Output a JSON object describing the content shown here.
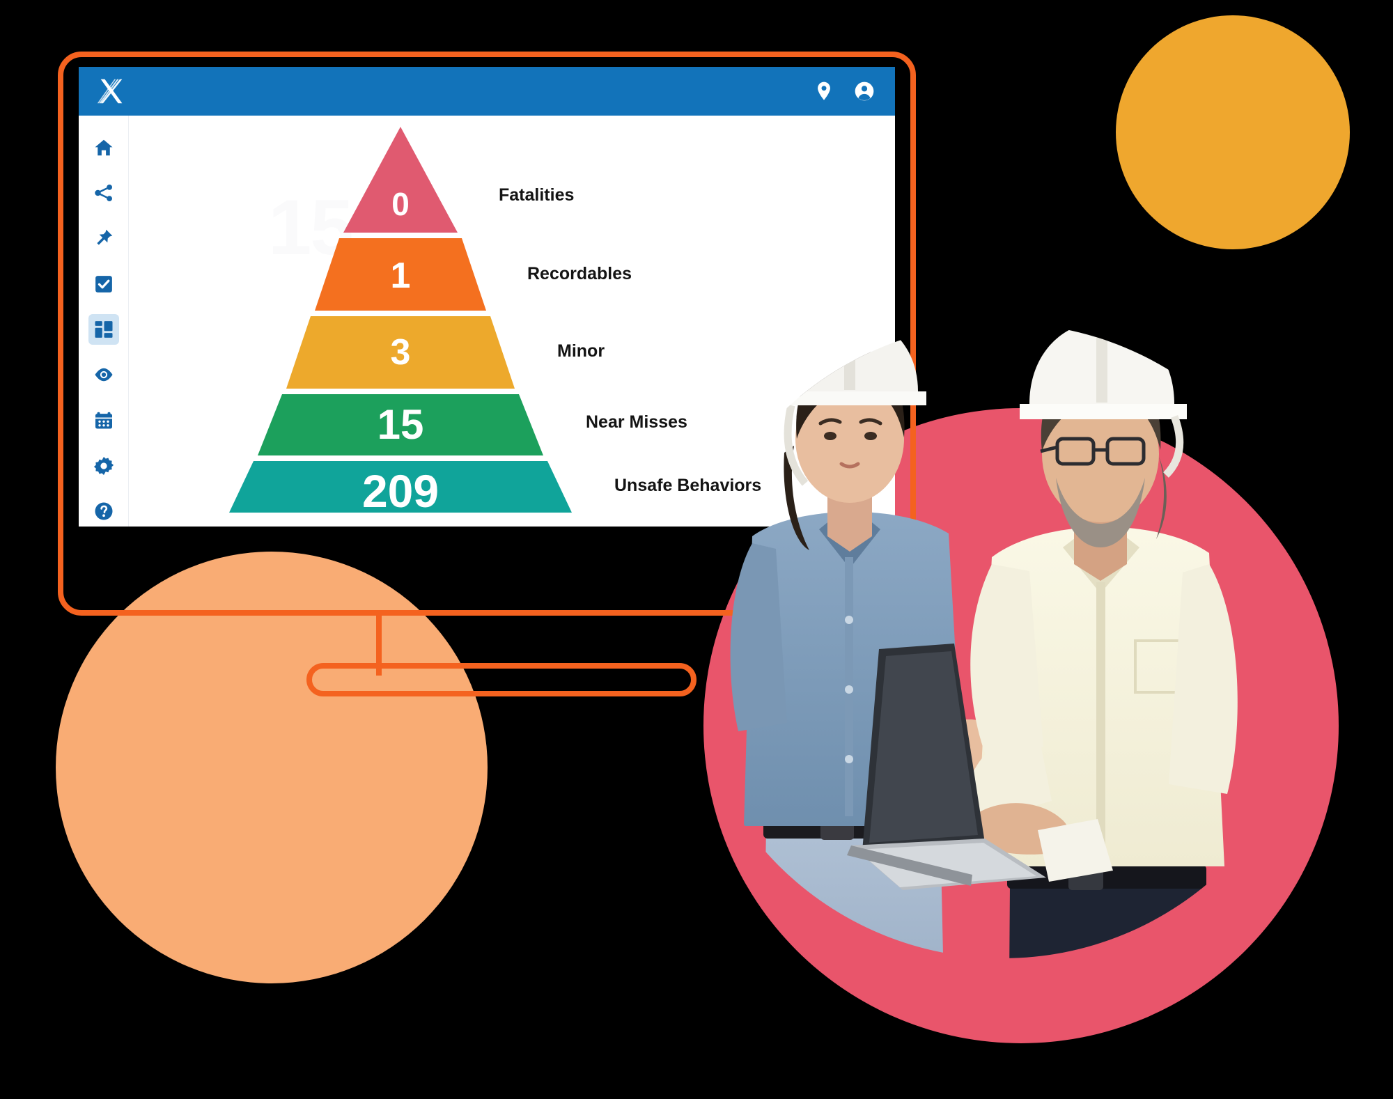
{
  "app": {
    "brand": {
      "logo_icon": "x-logo-icon",
      "logo_alt": "X"
    },
    "header": {
      "location_icon": "location-pin-icon",
      "account_icon": "user-account-icon",
      "background_color": "#1273BA"
    },
    "sidebar": {
      "items": [
        {
          "icon": "home-icon",
          "label": "Home",
          "active": false
        },
        {
          "icon": "share-icon",
          "label": "Share",
          "active": false
        },
        {
          "icon": "pin-icon",
          "label": "Pinned",
          "active": false
        },
        {
          "icon": "checkbox-icon",
          "label": "Tasks",
          "active": false
        },
        {
          "icon": "dashboard-icon",
          "label": "Dashboard",
          "active": true
        },
        {
          "icon": "eye-icon",
          "label": "Observations",
          "active": false
        },
        {
          "icon": "calendar-icon",
          "label": "Calendar",
          "active": false
        },
        {
          "icon": "gear-icon",
          "label": "Settings",
          "active": false
        },
        {
          "icon": "help-icon",
          "label": "Help",
          "active": false
        }
      ]
    },
    "content": {
      "watermark_text": "15"
    }
  },
  "chart_data": {
    "type": "pie",
    "chart_style": "safety-triangle-pyramid",
    "title": "",
    "categories": [
      "Fatalities",
      "Recordables",
      "Minor",
      "Near Misses",
      "Unsafe Behaviors"
    ],
    "values": [
      0,
      1,
      3,
      15,
      209
    ],
    "value_labels": [
      "0",
      "1",
      "3",
      "15",
      "209"
    ],
    "colors": [
      "#E05A70",
      "#F4701F",
      "#EDA92C",
      "#1CA05C",
      "#10A49A"
    ],
    "tiers": [
      {
        "label": "Fatalities",
        "value": "0",
        "color": "#E05A70"
      },
      {
        "label": "Recordables",
        "value": "1",
        "color": "#F4701F"
      },
      {
        "label": "Minor",
        "value": "3",
        "color": "#EDA92C"
      },
      {
        "label": "Near Misses",
        "value": "15",
        "color": "#1CA05C"
      },
      {
        "label": "Unsafe Behaviors",
        "value": "209",
        "color": "#10A49A"
      }
    ],
    "xlabel": "",
    "ylabel": "",
    "legend_position": "right",
    "grid": false
  },
  "decor": {
    "monitor_border_color": "#F4621F",
    "circle_yellow_color": "#EFA72E",
    "circle_pink_color": "#E9556B",
    "circle_peach_color": "#F9AC74",
    "photo_description": "Two construction workers in white hard hats reviewing a laptop"
  }
}
